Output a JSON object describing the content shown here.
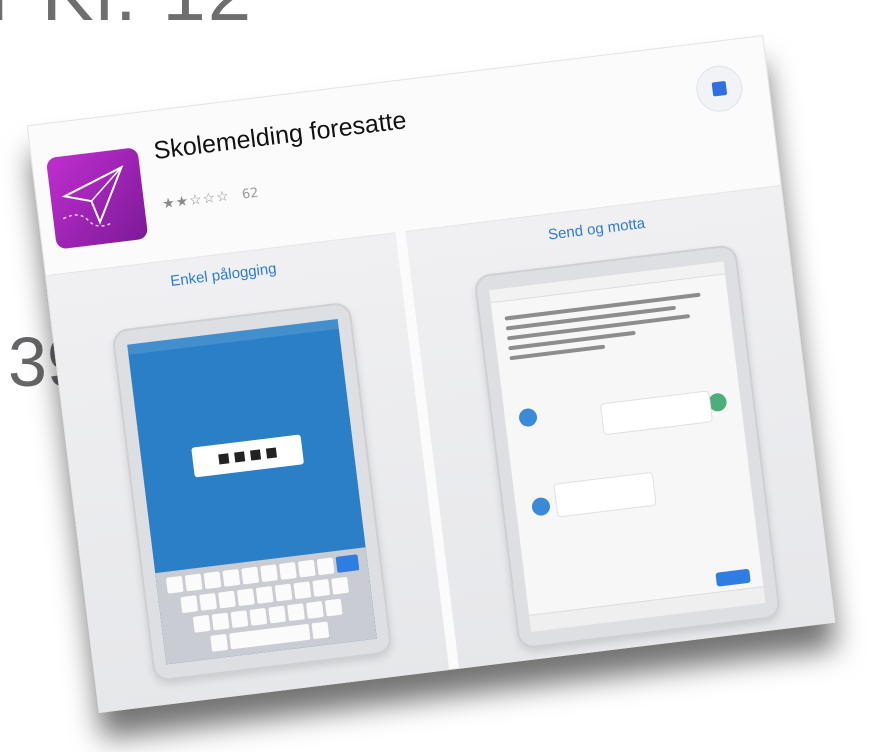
{
  "background": {
    "heading_text": "r Kl. 12",
    "number_text": "39"
  },
  "app_store": {
    "app_title": "Skolemelding foresatte",
    "developer": "",
    "rating_stars": "★★☆☆☆",
    "rating_count": "62"
  },
  "colors": {
    "accent": "#2c7bd9",
    "icon_purple": "#b02ac7",
    "login_blue": "#2a7fc6"
  },
  "screenshots": [
    {
      "caption": "Enkel pålogging",
      "subtitle": ""
    },
    {
      "caption": "Send og motta",
      "subtitle": ""
    }
  ]
}
